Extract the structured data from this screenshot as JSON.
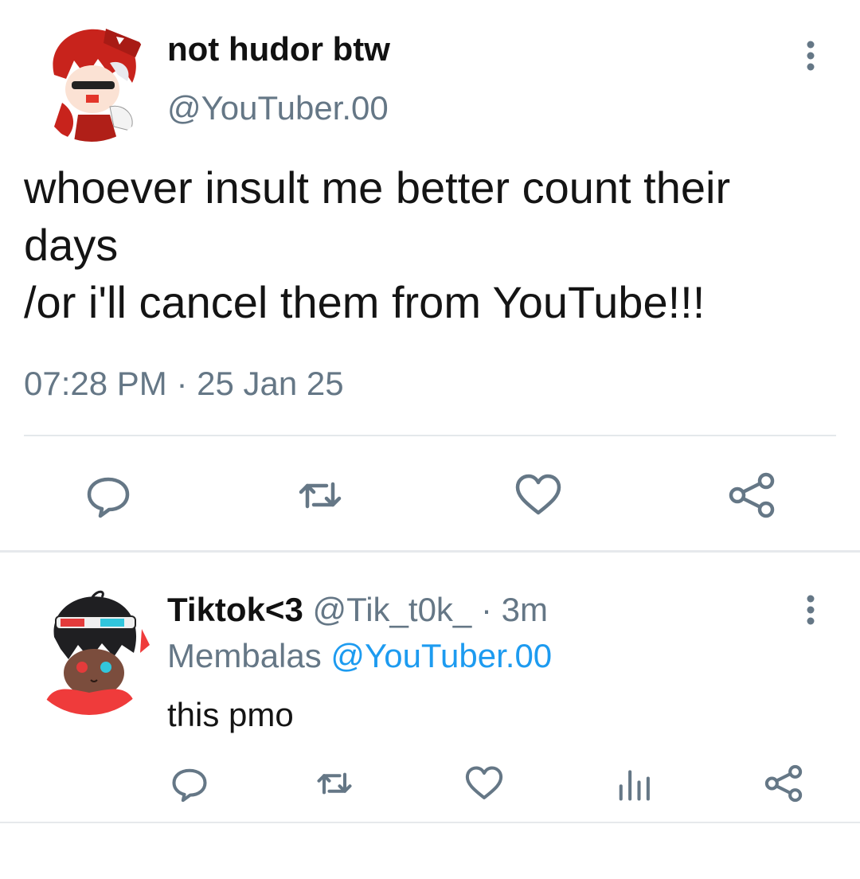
{
  "tweet": {
    "display_name": "not hudor btw",
    "handle": "@YouTuber.00",
    "text": "whoever insult me better count their\ndays\n/or i'll cancel them from YouTube!!!",
    "time": "07:28 PM",
    "separator": "·",
    "date": "25 Jan 25",
    "avatar_icon": "anime-avatar-red-hair",
    "actions": [
      "reply-icon",
      "retweet-icon",
      "like-icon",
      "share-icon"
    ]
  },
  "reply": {
    "display_name": "Tiktok<3",
    "handle": "@Tik_t0k_",
    "separator": "·",
    "age": "3m",
    "replying_label": "Membalas",
    "replying_to": "@YouTuber.00",
    "text": "this pmo",
    "avatar_icon": "anime-avatar-3d-glasses",
    "actions": [
      "reply-icon",
      "retweet-icon",
      "like-icon",
      "views-icon",
      "share-icon"
    ]
  },
  "colors": {
    "muted": "#657786",
    "link": "#1d9bf0",
    "divider": "#e4e8eb"
  }
}
